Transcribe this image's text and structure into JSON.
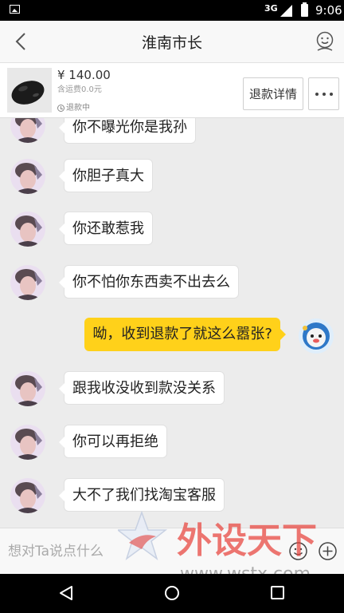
{
  "status_bar": {
    "network": "3G",
    "time": "9:06"
  },
  "header": {
    "title": "淮南市长"
  },
  "order": {
    "price": "¥ 140.00",
    "shipping": "含运费0.0元",
    "status": "退款中",
    "refund_button": "退款详情"
  },
  "messages": [
    {
      "side": "left",
      "text": "你不曝光你是我孙"
    },
    {
      "side": "left",
      "text": "你胆子真大"
    },
    {
      "side": "left",
      "text": "你还敢惹我"
    },
    {
      "side": "left",
      "text": "你不怕你东西卖不出去么"
    },
    {
      "side": "right",
      "text": "呦，收到退款了就这么嚣张?"
    },
    {
      "side": "left",
      "text": "跟我收没收到款没关系"
    },
    {
      "side": "left",
      "text": "你可以再拒绝"
    },
    {
      "side": "left",
      "text": "大不了我们找淘宝客服"
    }
  ],
  "input": {
    "placeholder": "想对Ta说点什么"
  },
  "watermark": {
    "brand": "外设天下",
    "url": "www.wstx.com"
  },
  "colors": {
    "accent": "#ffd11a"
  }
}
